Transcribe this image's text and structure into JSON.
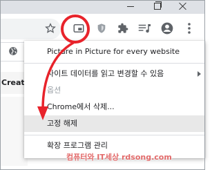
{
  "toolbar": {
    "icons": [
      "star-icon",
      "pip-extension-icon",
      "shield-extension-icon",
      "puzzle-icon",
      "media-control-icon",
      "profile-icon",
      "kebab-menu-icon"
    ]
  },
  "page": {
    "partial_text": "Creato"
  },
  "menu": {
    "items": [
      {
        "label": "Picture in Picture for every website",
        "state": "normal"
      },
      {
        "label": "사이트 데이터를 읽고 변경할 수 있음",
        "state": "normal",
        "submenu": true
      },
      {
        "label": "옵션",
        "state": "disabled"
      },
      {
        "label": "Chrome에서 삭제...",
        "state": "normal"
      },
      {
        "label": "고정 해제",
        "state": "hovered"
      },
      {
        "label": "확장 프로그램 관리",
        "state": "normal"
      }
    ]
  },
  "watermark": "컴퓨터와 IT세상 rdsong.com",
  "colors": {
    "highlight": "#e8232b",
    "menu_hover": "#e8e8e8",
    "titlebar": "#dee1e6"
  }
}
